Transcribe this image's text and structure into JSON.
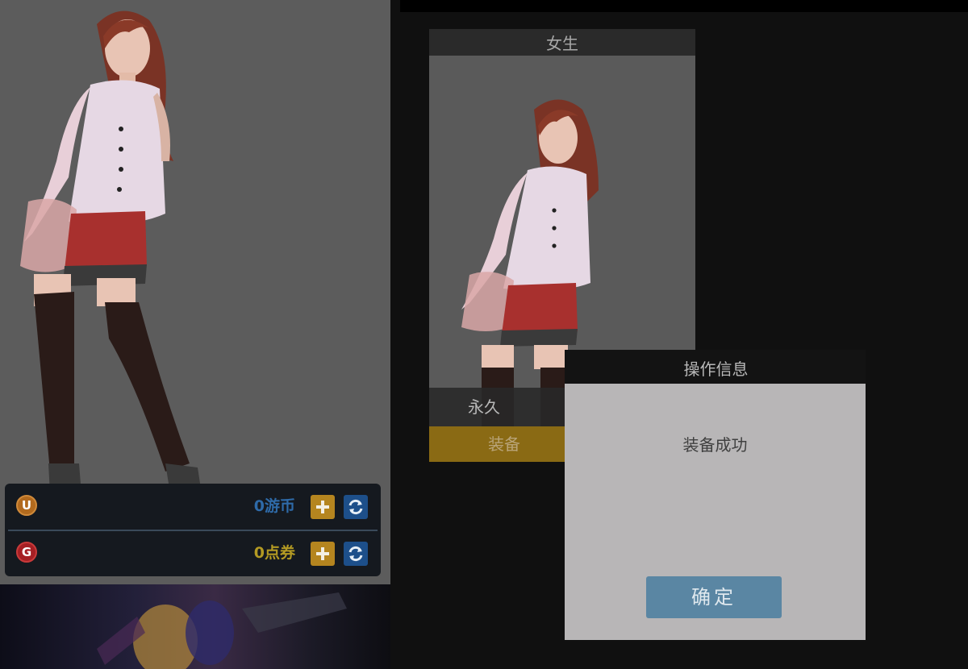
{
  "item_card": {
    "title": "女生",
    "duration": "永久",
    "equip_label": "装备"
  },
  "currency": {
    "coin": {
      "icon": "u-coin-icon",
      "value": "0游币"
    },
    "voucher": {
      "icon": "g-voucher-icon",
      "value": "0点券"
    }
  },
  "dialog": {
    "title": "操作信息",
    "message": "装备成功",
    "confirm_label": "确定"
  },
  "colors": {
    "equip": "#8a6a14",
    "confirm": "#5a86a3",
    "coin_text": "#2e6aa8",
    "voucher_text": "#b39a23"
  }
}
